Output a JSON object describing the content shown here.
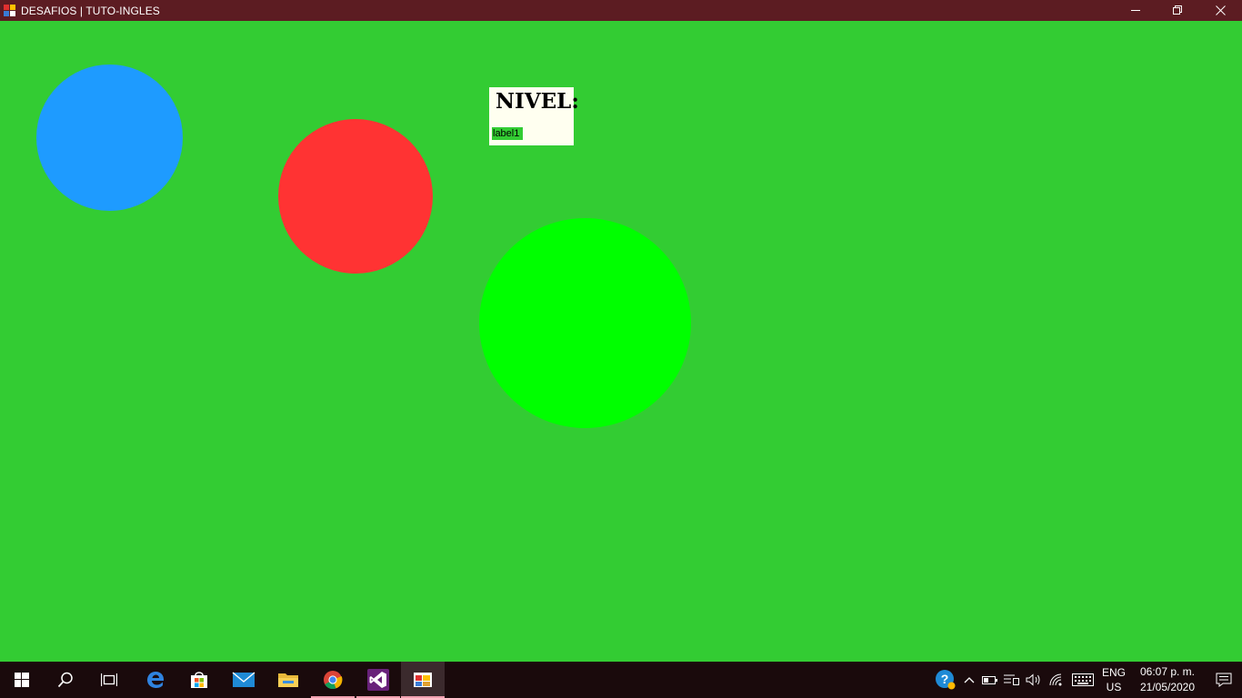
{
  "window": {
    "title": "DESAFIOS | TUTO-INGLES",
    "controls": {
      "minimize": "—",
      "restore": "❐",
      "close": "✕"
    }
  },
  "game": {
    "level_title": "NIVEL:",
    "level_value": "label1",
    "circles": [
      {
        "name": "blue",
        "color": "#1e9bff"
      },
      {
        "name": "red",
        "color": "#ff3333"
      },
      {
        "name": "green",
        "color": "#00ff00"
      }
    ],
    "background_color": "#33cc33"
  },
  "taskbar": {
    "apps": [
      "start-icon",
      "search-icon",
      "task-view-icon",
      "edge-icon",
      "store-icon",
      "mail-icon",
      "file-explorer-icon",
      "chrome-icon",
      "visual-studio-icon",
      "form-app-icon"
    ],
    "tray": {
      "lang_line1": "ENG",
      "lang_line2": "US",
      "time": "06:07 p. m.",
      "date": "21/05/2020"
    }
  }
}
